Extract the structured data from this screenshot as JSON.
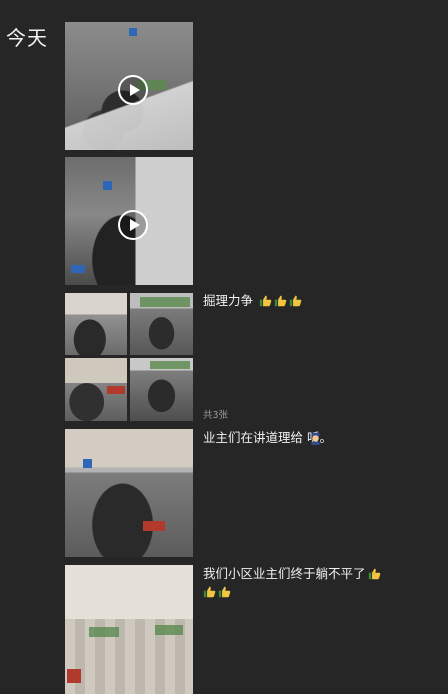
{
  "header": {
    "date_label": "今天"
  },
  "posts": [
    {
      "type": "video",
      "caption": ""
    },
    {
      "type": "video",
      "caption": ""
    },
    {
      "type": "image-grid",
      "caption": "掘理力争",
      "count_label": "共3张"
    },
    {
      "type": "image",
      "caption": "业主们在讲道理给 听。"
    },
    {
      "type": "image",
      "caption_line1": "我们小区业主们终于躺不平了"
    }
  ],
  "icons": {
    "thumbs_up": "thumbs-up-icon",
    "police": "police-officer-icon",
    "play": "play-icon"
  },
  "colors": {
    "background": "#262626",
    "text": "#f0f0f0",
    "muted": "#9a9a9a"
  }
}
